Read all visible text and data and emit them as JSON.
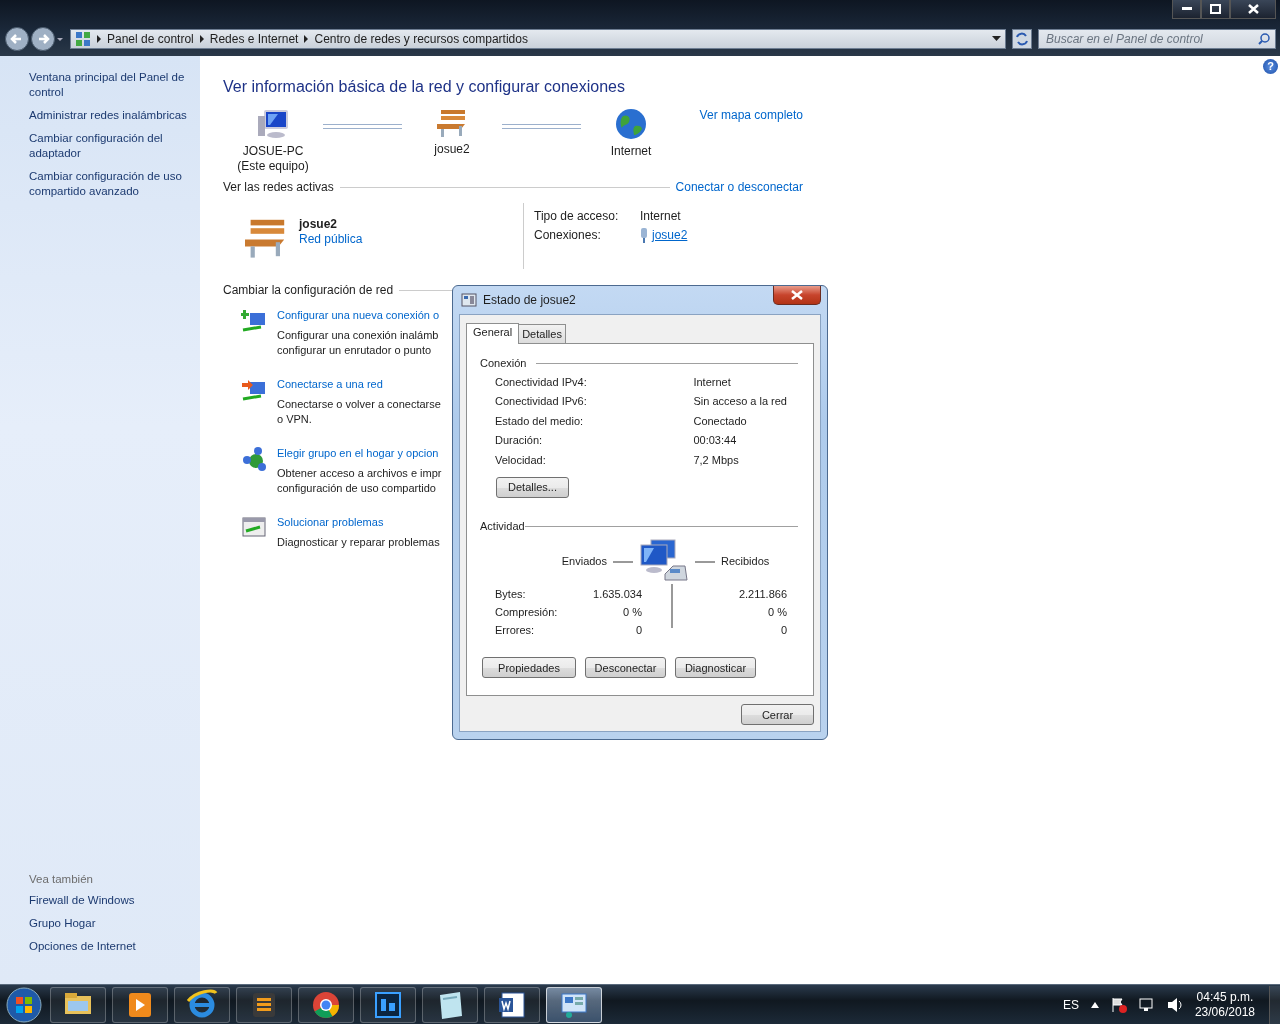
{
  "address_bar": {
    "breadcrumbs": [
      "Panel de control",
      "Redes e Internet",
      "Centro de redes y recursos compartidos"
    ],
    "search": {
      "placeholder": "Buscar en el Panel de control"
    }
  },
  "help_button": "?",
  "sidebar": {
    "links": [
      "Ventana principal del Panel de control",
      "Administrar redes inalámbricas",
      "Cambiar configuración del adaptador",
      "Cambiar configuración de uso compartido avanzado"
    ],
    "see_also_title": "Vea también",
    "see_also": [
      "Firewall de Windows",
      "Grupo Hogar",
      "Opciones de Internet"
    ]
  },
  "main": {
    "title": "Ver información básica de la red y configurar conexiones",
    "map": {
      "nodes": [
        {
          "kind": "computer",
          "label": "JOSUE-PC",
          "sublabel": "(Este equipo)"
        },
        {
          "kind": "network",
          "label": "josue2"
        },
        {
          "kind": "internet",
          "label": "Internet"
        }
      ],
      "full_map_link": "Ver mapa completo"
    },
    "active_networks": {
      "heading": "Ver las redes activas",
      "link": "Conectar o desconectar",
      "name": "josue2",
      "category": "Red pública",
      "access_label": "Tipo de acceso:",
      "access_value": "Internet",
      "connections_label": "Conexiones:",
      "connection_link": "josue2"
    },
    "change_settings": {
      "heading": "Cambiar la configuración de red",
      "tasks": [
        {
          "kind": "new-connection",
          "title": "Configurar una nueva conexión o",
          "description": [
            "Configurar una conexión inalámb",
            "configurar un enrutador o punto"
          ]
        },
        {
          "kind": "connect",
          "title": "Conectarse a una red",
          "description": [
            "Conectarse o volver a conectarse",
            "o VPN."
          ]
        },
        {
          "kind": "homegroup",
          "title": "Elegir grupo en el hogar y opcion",
          "description": [
            "Obtener acceso a archivos e impr",
            "configuración de uso compartido"
          ]
        },
        {
          "kind": "troubleshoot",
          "title": "Solucionar problemas",
          "description": [
            "Diagnosticar y reparar problemas"
          ]
        }
      ]
    }
  },
  "dialog": {
    "title": "Estado de josue2",
    "tabs": [
      {
        "label": "General",
        "selected": true
      },
      {
        "label": "Detalles",
        "selected": false
      }
    ],
    "connection": {
      "heading": "Conexión",
      "rows": [
        {
          "label": "Conectividad IPv4:",
          "value": "Internet"
        },
        {
          "label": "Conectividad IPv6:",
          "value": "Sin acceso a la red"
        },
        {
          "label": "Estado del medio:",
          "value": "Conectado"
        },
        {
          "label": "Duración:",
          "value": "00:03:44"
        },
        {
          "label": "Velocidad:",
          "value": "7,2 Mbps"
        }
      ]
    },
    "details_button": "Detalles...",
    "activity": {
      "heading": "Actividad",
      "sent_label": "Enviados",
      "received_label": "Recibidos",
      "rows": [
        {
          "label": "Bytes:",
          "sent": "1.635.034",
          "received": "2.211.866"
        },
        {
          "label": "Compresión:",
          "sent": "0 %",
          "received": "0 %"
        },
        {
          "label": "Errores:",
          "sent": "0",
          "received": "0"
        }
      ]
    },
    "buttons": [
      "Propiedades",
      "Desconectar",
      "Diagnosticar"
    ],
    "close_button": "Cerrar"
  },
  "taskbar": {
    "apps": [
      {
        "kind": "folder",
        "selected": false
      },
      {
        "kind": "media",
        "selected": false
      },
      {
        "kind": "browser",
        "selected": false
      },
      {
        "kind": "editor",
        "selected": false
      },
      {
        "kind": "chrome",
        "selected": false
      },
      {
        "kind": "photo",
        "selected": false
      },
      {
        "kind": "notes",
        "selected": false
      },
      {
        "kind": "word",
        "selected": false
      },
      {
        "kind": "control-panel",
        "selected": true
      }
    ],
    "language": "ES",
    "time": "04:45 p.m.",
    "date": "23/06/2018"
  }
}
